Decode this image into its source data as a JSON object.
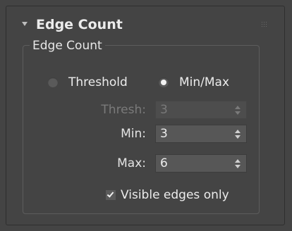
{
  "rollout": {
    "title": "Edge Count"
  },
  "group": {
    "title": "Edge Count"
  },
  "radios": [
    {
      "label": "Threshold",
      "checked": false
    },
    {
      "label": "Min/Max",
      "checked": true
    }
  ],
  "fields": {
    "thresh": {
      "label": "Thresh:",
      "value": "3",
      "disabled": true
    },
    "min": {
      "label": "Min:",
      "value": "3",
      "disabled": false
    },
    "max": {
      "label": "Max:",
      "value": "6",
      "disabled": false
    }
  },
  "visible_edges": {
    "label": "Visible edges only",
    "checked": true
  },
  "icons": [
    "chevron-down-icon",
    "grip-icon",
    "radio-icon",
    "spinner-arrows-icon",
    "checkmark-icon"
  ],
  "colors": {
    "panel_bg": "#444444",
    "field_bg": "#575757",
    "text": "#e4e4e4",
    "disabled_text": "#7a7a7a"
  }
}
